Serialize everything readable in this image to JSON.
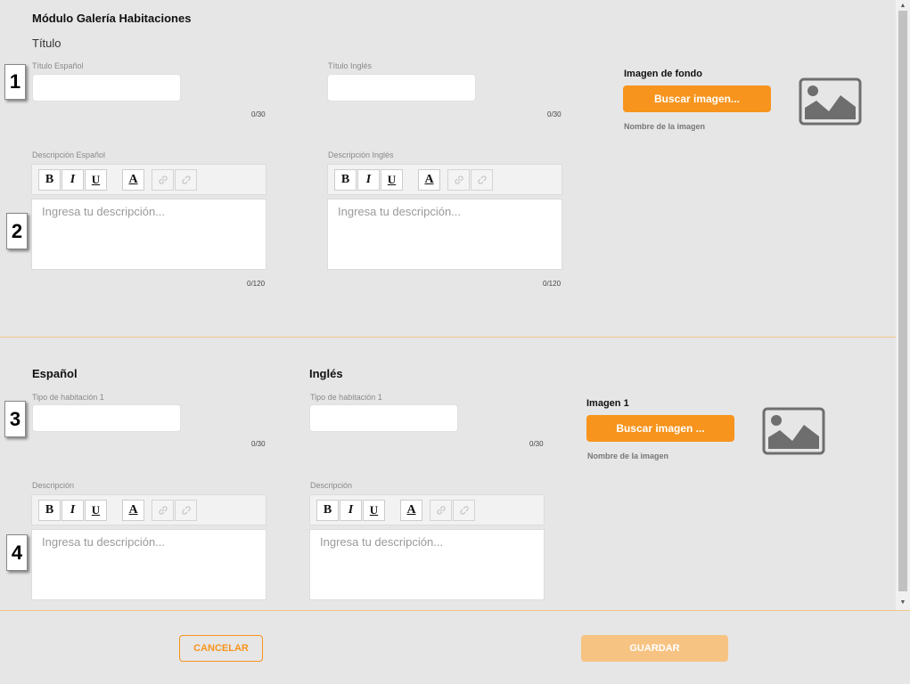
{
  "module": {
    "title": "Módulo Galería Habitaciones",
    "section_title": "Título"
  },
  "top": {
    "title_es_label": "Título Español",
    "title_es_value": "",
    "title_es_counter": "0/30",
    "title_en_label": "Título Inglés",
    "title_en_value": "",
    "title_en_counter": "0/30",
    "bg_image_title": "Imagen de fondo",
    "bg_image_button": "Buscar imagen...",
    "bg_image_name": "Nombre de la imagen",
    "desc_es_label": "Descripción Español",
    "desc_es_placeholder": "Ingresa tu descripción...",
    "desc_es_counter": "0/120",
    "desc_en_label": "Descripción Inglés",
    "desc_en_placeholder": "Ingresa tu descripción...",
    "desc_en_counter": "0/120"
  },
  "toolbar": {
    "bold": "B",
    "italic": "I",
    "underline": "U",
    "color": "A",
    "link": "🔗",
    "unlink": "⛓"
  },
  "rooms": {
    "es_heading": "Español",
    "en_heading": "Inglés",
    "room_type_es_label": "Tipo de habitación 1",
    "room_type_es_counter": "0/30",
    "room_type_en_label": "Tipo de habitación 1",
    "room_type_en_counter": "0/30",
    "image_title": "Imagen 1",
    "image_button": "Buscar imagen ...",
    "image_name": "Nombre de la imagen",
    "desc_es_label": "Descripción",
    "desc_es_placeholder": "Ingresa tu descripción...",
    "desc_en_label": "Descripción",
    "desc_en_placeholder": "Ingresa tu descripción..."
  },
  "markers": [
    "1",
    "2",
    "3",
    "4"
  ],
  "footer": {
    "cancel_label": "CANCELAR",
    "save_label": "GUARDAR"
  },
  "colors": {
    "accent": "#f7941d",
    "accent_disabled": "#f7c383",
    "background": "#e6e6e6"
  },
  "icons": {
    "image_placeholder": "image-icon",
    "link": "link-icon",
    "unlink": "unlink-icon"
  }
}
